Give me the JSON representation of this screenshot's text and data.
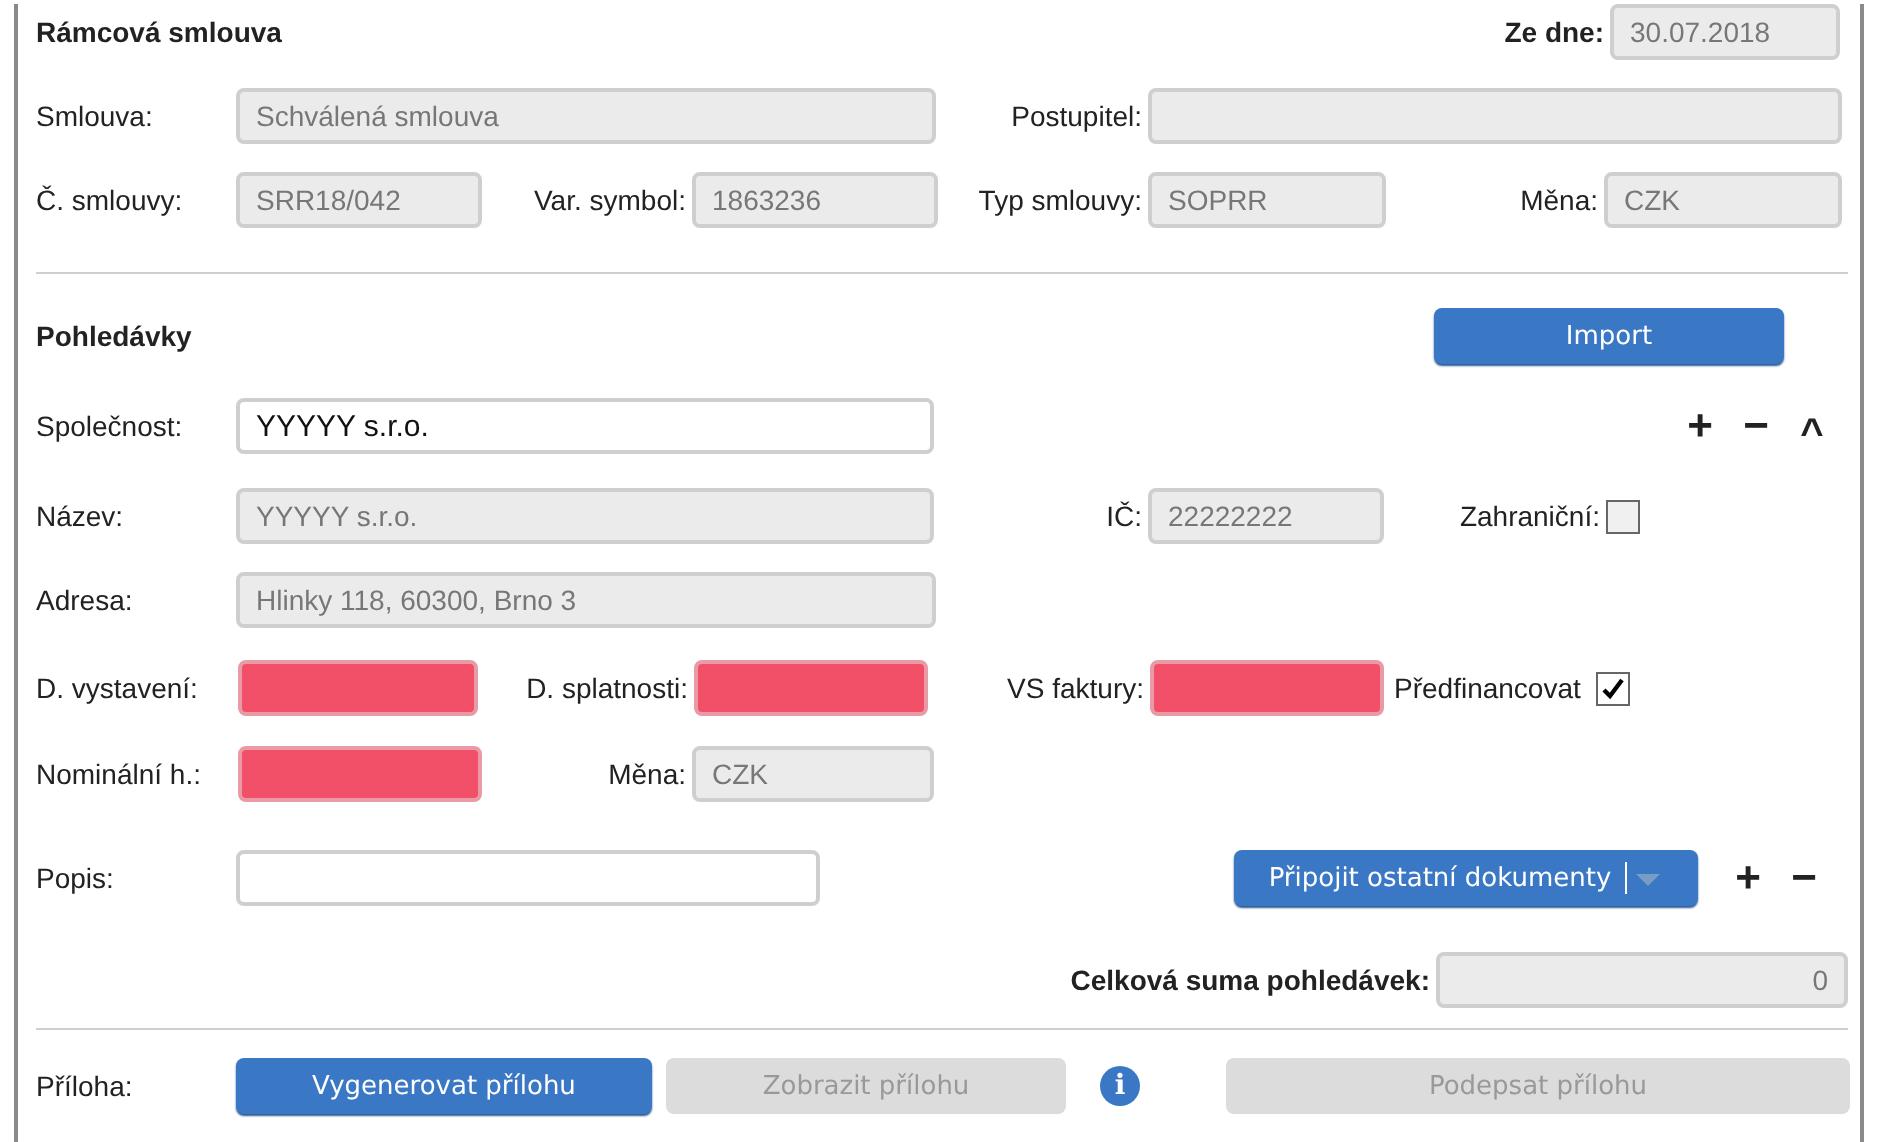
{
  "contract": {
    "title": "Rámcová smlouva",
    "date_label": "Ze dne:",
    "date": "30.07.2018",
    "contract_label": "Smlouva:",
    "contract_value": "Schválená smlouva",
    "assignee_label": "Postupitel:",
    "number_label": "Č. smlouvy:",
    "number_value": "SRR18/042",
    "var_symbol_label": "Var. symbol:",
    "var_symbol_value": "1863236",
    "type_label": "Typ smlouvy:",
    "type_value": "SOPRR",
    "currency_label": "Měna:",
    "currency_value": "CZK"
  },
  "receivables": {
    "title": "Pohledávky",
    "import_button": "Import",
    "add_symbol": "+",
    "remove_symbol": "−",
    "collapse_symbol": "^",
    "company_label": "Společnost:",
    "company_value": "YYYYY s.r.o.",
    "name_label": "Název:",
    "name_value": "YYYYY s.r.o.",
    "id_label": "IČ:",
    "id_value": "22222222",
    "foreign_label": "Zahraniční:",
    "foreign_checked": false,
    "address_label": "Adresa:",
    "address_value": "Hlinky 118, 60300, Brno 3",
    "issue_label": "D. vystavení:",
    "issue_invalid": true,
    "due_label": "D. splatnosti:",
    "due_invalid": true,
    "vs_label": "VS faktury:",
    "vs_invalid": true,
    "prefinance_label": "Předfinancovat",
    "prefinance_checked": true,
    "nominal_label": "Nominální h.:",
    "nominal_invalid": true,
    "nominal_currency_label": "Měna:",
    "nominal_currency_value": "CZK",
    "description_label": "Popis:",
    "attach_button": "Připojit ostatní dokumenty",
    "attach_add_symbol": "+",
    "attach_remove_symbol": "−",
    "total_label": "Celková suma pohledávek:",
    "total_value": "0"
  },
  "attachment": {
    "label": "Příloha:",
    "info_symbol": "i",
    "buttons": [
      {
        "label": "Vygenerovat přílohu",
        "disabled": false
      },
      {
        "label": "Zobrazit přílohu",
        "disabled": true
      },
      {
        "label": "Podepsat přílohu",
        "disabled": true
      }
    ]
  }
}
